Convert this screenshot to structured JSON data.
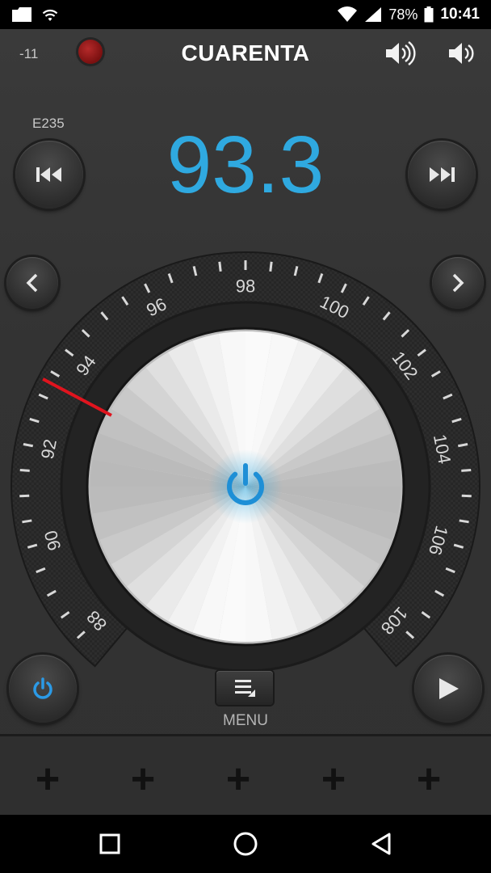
{
  "status_bar": {
    "battery": "78%",
    "time": "10:41",
    "icons": [
      "notification-icon",
      "wifi-icon",
      "signal-icon",
      "battery-icon"
    ]
  },
  "header": {
    "signal_db": "-11",
    "station_name": "CUARENTA"
  },
  "tuner": {
    "pi_code": "E235",
    "frequency": "93.3",
    "dial_ticks": [
      "88",
      "90",
      "92",
      "94",
      "96",
      "98",
      "100",
      "102",
      "104",
      "106",
      "108"
    ]
  },
  "controls": {
    "menu_label": "MENU"
  },
  "presets": {
    "slots": [
      "+",
      "+",
      "+",
      "+",
      "+"
    ]
  },
  "colors": {
    "accent": "#2fa9e0",
    "needle": "#e0141e",
    "record": "#8b1414"
  }
}
